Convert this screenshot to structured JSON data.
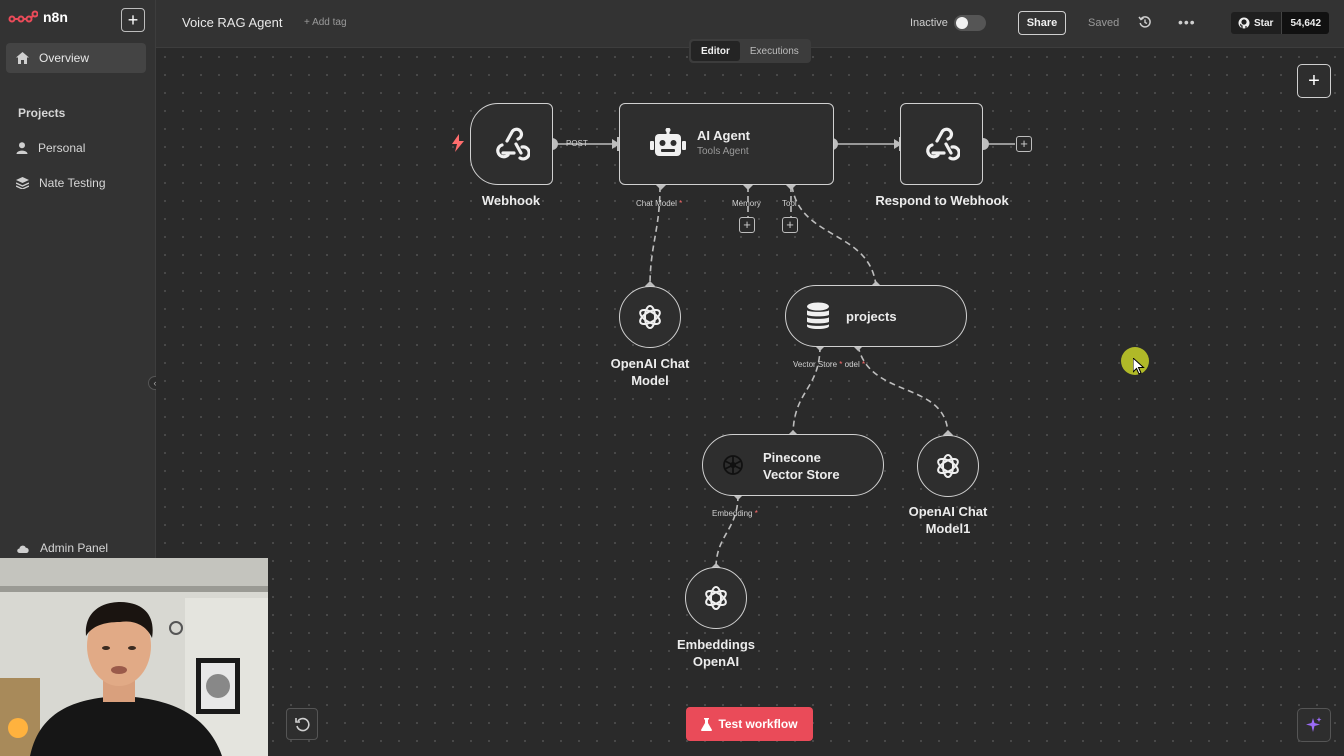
{
  "app": {
    "name": "n8n",
    "accent_color": "#ea4b59"
  },
  "sidebar": {
    "overview_label": "Overview",
    "projects_title": "Projects",
    "items": [
      {
        "label": "Personal",
        "icon": "user-icon"
      },
      {
        "label": "Nate Testing",
        "icon": "layers-icon"
      }
    ],
    "admin_label": "Admin Panel"
  },
  "header": {
    "workflow_name": "Voice RAG Agent",
    "add_tag_label": "+ Add tag",
    "status_label": "Inactive",
    "share_label": "Share",
    "saved_label": "Saved",
    "github": {
      "star_label": "Star",
      "count": "54,642"
    }
  },
  "tabs": [
    {
      "label": "Editor",
      "active": true
    },
    {
      "label": "Executions",
      "active": false
    }
  ],
  "nodes": {
    "webhook": {
      "label": "Webhook"
    },
    "agent": {
      "title": "AI Agent",
      "subtitle": "Tools Agent"
    },
    "respond": {
      "label": "Respond to Webhook"
    },
    "chat_model": {
      "label_line1": "OpenAI Chat",
      "label_line2": "Model"
    },
    "projects": {
      "label": "projects"
    },
    "pinecone": {
      "label_line1": "Pinecone",
      "label_line2": "Vector Store"
    },
    "chat_model1": {
      "label_line1": "OpenAI Chat",
      "label_line2": "Model1"
    },
    "embeddings": {
      "label_line1": "Embeddings",
      "label_line2": "OpenAI"
    }
  },
  "edge_labels": {
    "post": "POST"
  },
  "ports": {
    "chat_model": "Chat Model",
    "memory": "Memory",
    "tool": "Tool",
    "vector_store": "Vector Store",
    "model": "odel",
    "embedding": "Embedding",
    "required_mark": "*"
  },
  "footer": {
    "test_label": "Test workflow"
  }
}
